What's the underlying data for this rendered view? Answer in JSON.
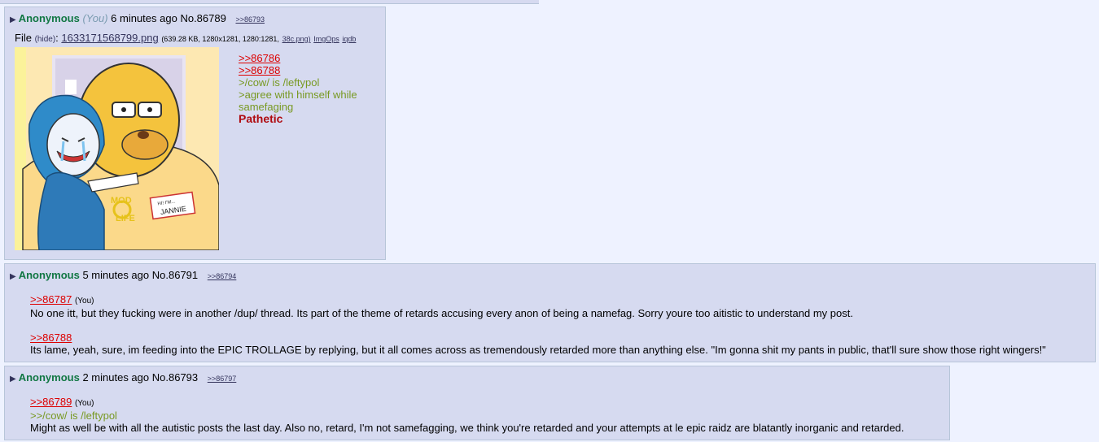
{
  "posts": [
    {
      "name": "Anonymous",
      "you_tag": "(You)",
      "date": "6 minutes ago",
      "postnum": "No.86789",
      "backlinks": [
        ">>86793"
      ],
      "file": {
        "label": "File",
        "hide": "(hide)",
        "filename": "1633171568799.png",
        "meta": "(639.28 KB, 1280x1281, 1280:1281,",
        "ext": "38c.png)",
        "tools": [
          "ImgOps",
          "iqdb"
        ]
      },
      "quotes": [
        ">>86786",
        ">>86788"
      ],
      "green": [
        ">/cow/ is /leftypol",
        ">agree with himself while",
        "samefaging"
      ],
      "red": "Pathetic",
      "image_text": [
        "HI! I'M...",
        "JANNIE",
        "MOD",
        "LIFE"
      ]
    },
    {
      "name": "Anonymous",
      "date": "5 minutes ago",
      "postnum": "No.86791",
      "backlinks": [
        ">>86794"
      ],
      "blocks": [
        {
          "quote": ">>86787",
          "you": "(You)",
          "text": "No one itt, but they fucking were in another /dup/ thread. Its part of the theme of retards accusing every anon of being a namefag. Sorry youre too aitistic to understand my post."
        },
        {
          "quote": ">>86788",
          "text": "Its lame, yeah, sure, im feeding into the EPIC TROLLAGE by replying, but it all comes across as tremendously retarded more than anything else. \"Im gonna shit my pants in public, that'll sure show those right wingers!\""
        }
      ]
    },
    {
      "name": "Anonymous",
      "date": "2 minutes ago",
      "postnum": "No.86793",
      "backlinks": [
        ">>86797"
      ],
      "quote": ">>86789",
      "you": "(You)",
      "green": ">>/cow/ is /leftypol",
      "text": "Might as well be with all the autistic posts the last day. Also no, retard, I'm not samefagging, we think you're retarded and your attempts at le epic raidz are blatantly inorganic and retarded."
    }
  ],
  "colors": {
    "background": "#eef2ff",
    "post_bg": "#d6daf0",
    "name": "#117743",
    "quote_link": "#dd0000",
    "greentext": "#789922",
    "red_text": "#af0a0f"
  },
  "icons": {
    "post_arrow": "triangle-right-icon"
  }
}
